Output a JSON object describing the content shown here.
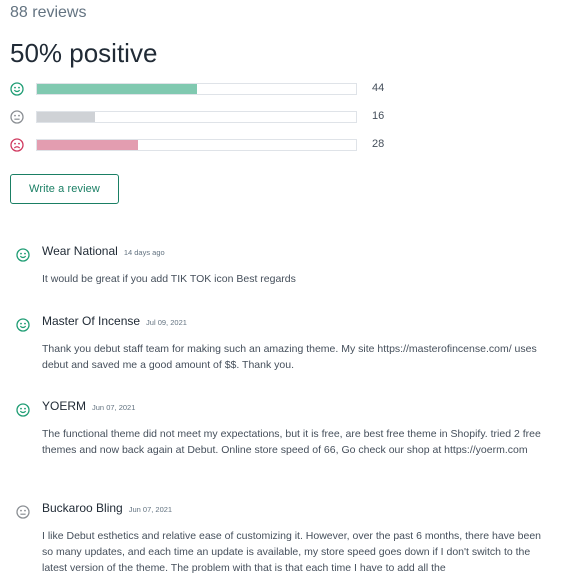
{
  "summary": {
    "reviews_count": "88 reviews",
    "positive_label": "50% positive"
  },
  "ratings": [
    {
      "type": "positive",
      "icon": "smile-icon",
      "count": "44",
      "fraction": 0.5,
      "color": "#80c9b0"
    },
    {
      "type": "neutral",
      "icon": "neutral-face-icon",
      "count": "16",
      "fraction": 0.182,
      "color": "#cfd2d6"
    },
    {
      "type": "negative",
      "icon": "frown-face-icon",
      "count": "28",
      "fraction": 0.318,
      "color": "#e39db0"
    }
  ],
  "write_review_label": "Write a review",
  "colors": {
    "positive": "#1f9d74",
    "neutral": "#8b8f94",
    "negative": "#d0395f",
    "accent": "#1a7f64"
  },
  "reviews": [
    {
      "author": "Wear National",
      "date": "14 days ago",
      "sentiment": "positive",
      "text": "It would be great if you add TIK TOK icon Best regards"
    },
    {
      "author": "Master Of Incense",
      "date": "Jul 09, 2021",
      "sentiment": "positive",
      "text": "Thank you debut staff team for making such an amazing theme. My site https://masterofincense.com/ uses debut and saved me a good amount of $$. Thank you."
    },
    {
      "author": "YOERM",
      "date": "Jun 07, 2021",
      "sentiment": "positive",
      "text": "The functional theme did not meet my expectations, but it is free, are best free theme in Shopify. tried 2 free themes and now back again at Debut. Online store speed of 66, Go check our shop at https://yoerm.com"
    },
    {
      "author": "Buckaroo Bling",
      "date": "Jun 07, 2021",
      "sentiment": "neutral",
      "text": "I like Debut esthetics and relative ease of customizing it. However, over the past 6 months, there have been so many updates, and each time an update is available, my store speed goes down if I don't switch to the latest version of the theme. The problem with that is that each time I have to add all the"
    }
  ]
}
